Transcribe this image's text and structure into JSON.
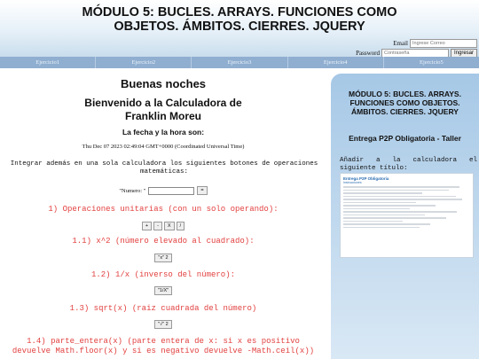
{
  "header": {
    "title_line1": "MÓDULO 5: BUCLES. ARRAYS. FUNCIONES COMO",
    "title_line2": "OBJETOS. ÁMBITOS. CIERRES. JQUERY",
    "email_label": "Email",
    "email_placeholder": "Ingrese Correo",
    "password_label": "Password",
    "password_placeholder": "Contraseña",
    "login_button": "Ingresar"
  },
  "nav": {
    "tabs": [
      "Ejercicio1",
      "Ejercicio2",
      "Ejercicio3",
      "Ejercicio4",
      "Ejercicio5"
    ]
  },
  "main": {
    "greeting": "Buenas noches",
    "welcome": "Bienvenido a la Calculadora de Franklin Moreu",
    "date_heading": "La fecha y la hora son:",
    "date_value": "Thu Dec 07 2023 02:49:04 GMT+0000 (Coordinated Universal Time)",
    "intro": "Integrar además en una sola calculadora los siguientes botones de operaciones matemáticas:",
    "number_label": "\"Numero: \"",
    "number_button": "=",
    "section1": "1) Operaciones unitarias (con un solo operando):",
    "ops": [
      "+",
      "-",
      "X",
      "/"
    ],
    "s11": "1.1) x^2 (número elevado al cuadrado):",
    "s11_btn": "\"x\" 2",
    "s12": "1.2) 1/x (inverso del número):",
    "s12_btn": "\"1/X\"",
    "s13": "1.3) sqrt(x) (raiz cuadrada del número)",
    "s13_btn": "\"√\" 2",
    "s14": "1.4) parte_entera(x) (parte entera de x: si x es positivo devuelve Math.floor(x) y si es negativo devuelve -Math.ceil(x))"
  },
  "sidebar": {
    "title": "MÓDULO 5: BUCLES. ARRAYS. FUNCIONES COMO OBJETOS. ÁMBITOS. CIERRES. JQUERY",
    "subtitle": "Entrega P2P Obligatoria - Taller",
    "add_text": "Añadir a la calculadora el siguiente título:",
    "thumb_title": "Entrega P2P Obligatoria",
    "thumb_sub": "Instrucciones"
  }
}
